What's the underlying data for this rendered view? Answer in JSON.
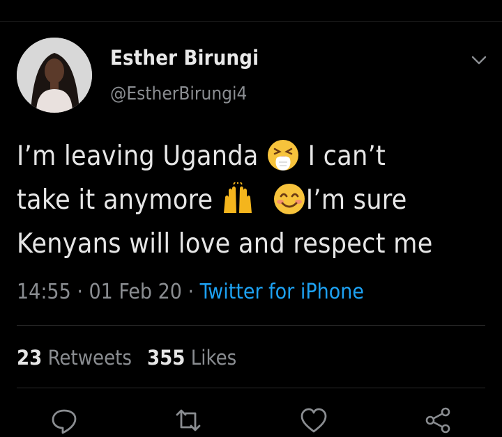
{
  "author": {
    "name": "Esther Birungi",
    "handle": "@EstherBirungi4"
  },
  "tweet": {
    "line1_text1": "I’m leaving Uganda ",
    "line1_text2": " I can’t",
    "line2_text1": "take it anymore ",
    "line2_text2": "I’m sure",
    "line3_text": "Kenyans will love and respect me",
    "emojis": [
      "sneezing-face-icon",
      "raising-hands-icon",
      "smiling-face-icon"
    ]
  },
  "meta": {
    "time": "14:55",
    "sep1": " · ",
    "date": "01 Feb 20",
    "sep2": " · ",
    "source": "Twitter for iPhone"
  },
  "stats": {
    "retweets_count": "23",
    "retweets_label": "Retweets",
    "likes_count": "355",
    "likes_label": "Likes"
  },
  "actions": [
    "reply-icon",
    "retweet-icon",
    "like-icon",
    "share-icon"
  ],
  "colors": {
    "background": "#000000",
    "accent": "#1da1f2",
    "secondary_text": "#8a8d91"
  }
}
